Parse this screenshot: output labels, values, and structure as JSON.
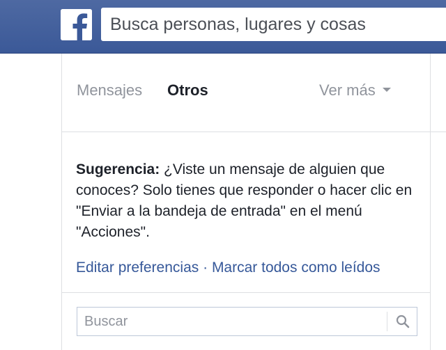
{
  "topbar": {
    "logo_icon": "facebook-f-icon",
    "search_placeholder": "Busca personas, lugares y cosas",
    "brand_color": "#3b5998"
  },
  "tabs": {
    "mensajes": "Mensajes",
    "otros": "Otros",
    "ver_mas": "Ver más"
  },
  "tip": {
    "label": "Sugerencia:",
    "text": " ¿Viste un mensaje de alguien que conoces? Solo tienes que responder o hacer clic en \"Enviar a la bandeja de entrada\" en el menú \"Acciones\"."
  },
  "links": {
    "edit_prefs": "Editar preferencias",
    "separator": " · ",
    "mark_all_read": "Marcar todos como leídos"
  },
  "search": {
    "placeholder": "Buscar",
    "icon": "search-icon"
  },
  "colors": {
    "link": "#365899",
    "muted": "#90949c",
    "text": "#1d2129"
  }
}
